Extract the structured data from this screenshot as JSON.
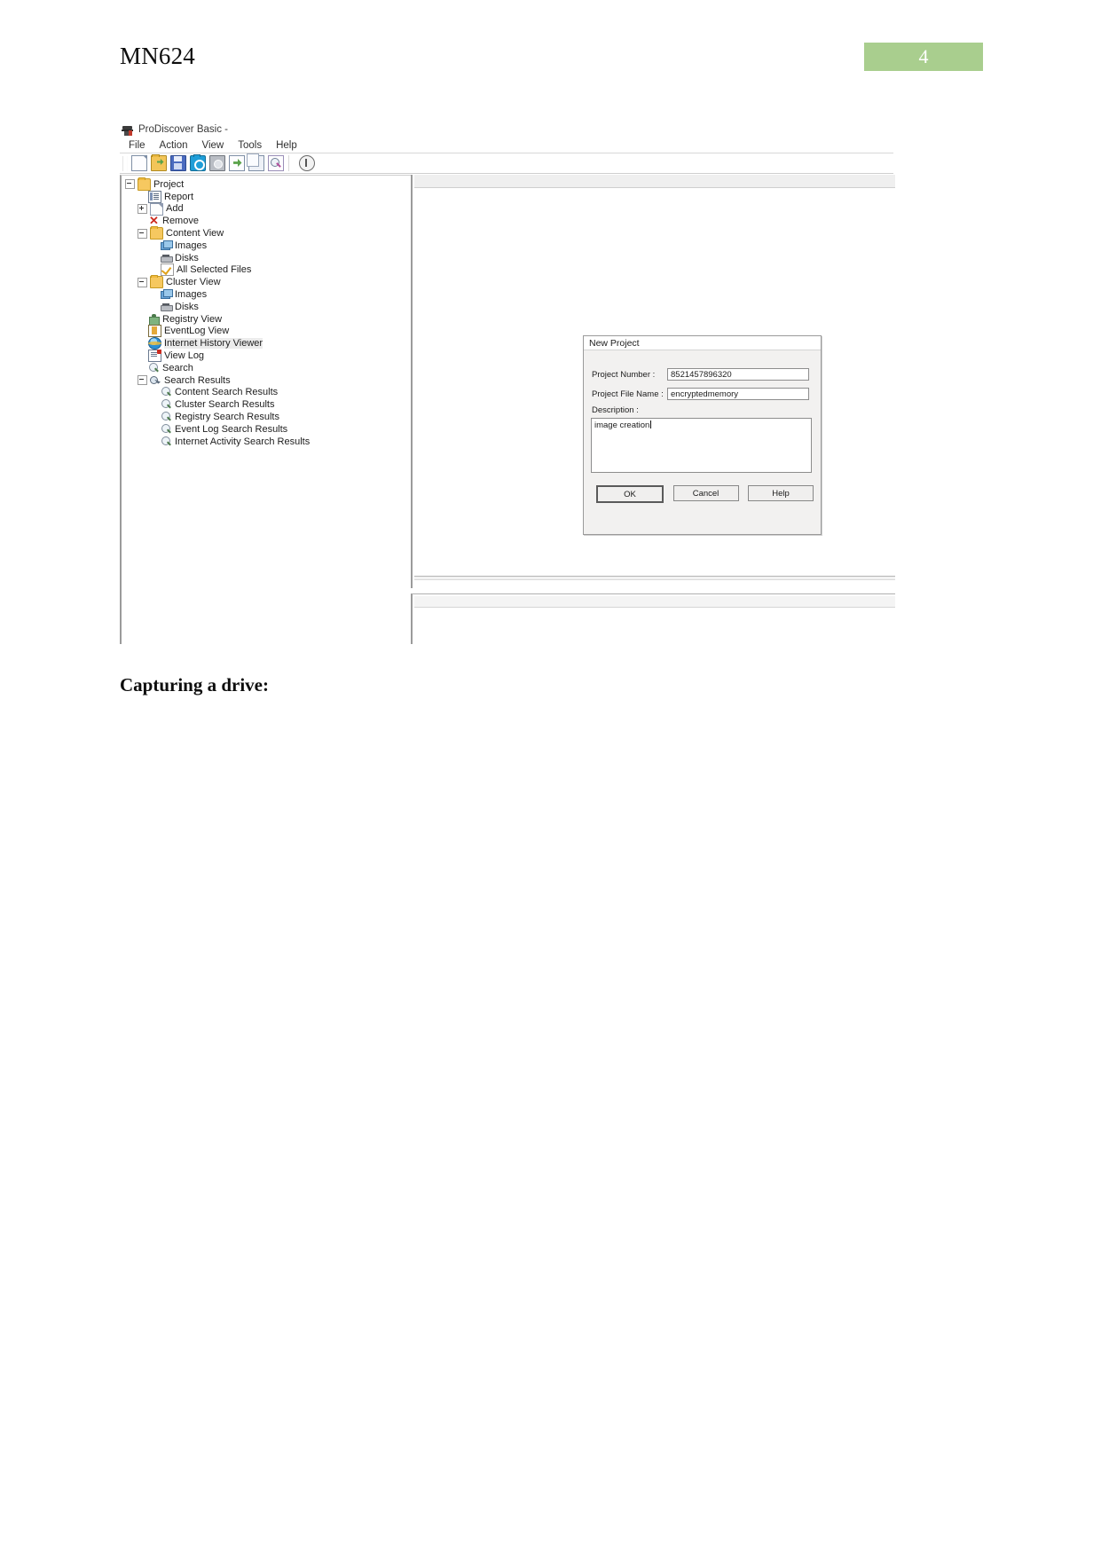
{
  "document": {
    "header_title": "MN624",
    "page_number": "4",
    "caption": "Capturing a drive:",
    "accent_color": "#a9ce8e"
  },
  "app": {
    "title": "ProDiscover Basic -",
    "window_icon": "prodiscover-detective-icon",
    "menu": [
      {
        "label": "File"
      },
      {
        "label": "Action"
      },
      {
        "label": "View"
      },
      {
        "label": "Tools"
      },
      {
        "label": "Help"
      }
    ],
    "toolbar": [
      {
        "name": "new-project-icon",
        "glyph": "g-new",
        "title": "New Project"
      },
      {
        "name": "open-project-icon",
        "glyph": "g-open",
        "title": "Open Project"
      },
      {
        "name": "save-project-icon",
        "glyph": "g-save",
        "title": "Save Project"
      },
      {
        "name": "capture-image-icon",
        "glyph": "g-cam",
        "title": "Capture Image"
      },
      {
        "name": "add-image-icon",
        "glyph": "g-disksave",
        "title": "Add Image"
      },
      {
        "name": "add-disk-icon",
        "glyph": "g-docarrow",
        "title": "Add Disk"
      },
      {
        "name": "copy-icon",
        "glyph": "g-copy",
        "title": "Copy"
      },
      {
        "name": "search-icon",
        "glyph": "g-find",
        "title": "Search"
      },
      {
        "name": "about-icon",
        "glyph": "g-info",
        "title": "About"
      }
    ],
    "tree": [
      {
        "label": "Project",
        "indent": 0,
        "toggle": "minus",
        "icon": "ico-folder",
        "icon_name": "folder-icon"
      },
      {
        "label": "Report",
        "indent": 1,
        "toggle": "none",
        "icon": "ico-report",
        "icon_name": "report-icon"
      },
      {
        "label": "Add",
        "indent": 1,
        "toggle": "plus",
        "icon": "ico-doc",
        "icon_name": "document-add-icon"
      },
      {
        "label": "Remove",
        "indent": 1,
        "toggle": "none",
        "icon": "ico-x",
        "icon_name": "remove-x-icon"
      },
      {
        "label": "Content View",
        "indent": 1,
        "toggle": "minus",
        "icon": "ico-folder",
        "icon_name": "folder-icon"
      },
      {
        "label": "Images",
        "indent": 2,
        "toggle": "none",
        "icon": "ico-images",
        "icon_name": "images-icon"
      },
      {
        "label": "Disks",
        "indent": 2,
        "toggle": "none",
        "icon": "ico-disk",
        "icon_name": "disk-icon"
      },
      {
        "label": "All Selected Files",
        "indent": 2,
        "toggle": "none",
        "icon": "ico-check",
        "icon_name": "checked-files-icon"
      },
      {
        "label": "Cluster View",
        "indent": 1,
        "toggle": "minus",
        "icon": "ico-folder",
        "icon_name": "folder-icon"
      },
      {
        "label": "Images",
        "indent": 2,
        "toggle": "none",
        "icon": "ico-images",
        "icon_name": "images-icon"
      },
      {
        "label": "Disks",
        "indent": 2,
        "toggle": "none",
        "icon": "ico-disk",
        "icon_name": "disk-icon"
      },
      {
        "label": "Registry View",
        "indent": 1,
        "toggle": "none",
        "icon": "ico-reg",
        "icon_name": "registry-icon"
      },
      {
        "label": "EventLog View",
        "indent": 1,
        "toggle": "none",
        "icon": "ico-event",
        "icon_name": "eventlog-icon"
      },
      {
        "label": "Internet History Viewer",
        "indent": 1,
        "toggle": "none",
        "icon": "ico-ie",
        "icon_name": "internet-explorer-icon",
        "highlight": true
      },
      {
        "label": "View Log",
        "indent": 1,
        "toggle": "none",
        "icon": "ico-viewlog",
        "icon_name": "view-log-icon"
      },
      {
        "label": "Search",
        "indent": 1,
        "toggle": "none",
        "icon": "ico-search",
        "icon_name": "magnifier-icon"
      },
      {
        "label": "Search Results",
        "indent": 1,
        "toggle": "minus",
        "icon": "ico-sr",
        "icon_name": "search-results-icon"
      },
      {
        "label": "Content Search Results",
        "indent": 2,
        "toggle": "none",
        "icon": "ico-search",
        "icon_name": "magnifier-icon"
      },
      {
        "label": "Cluster Search Results",
        "indent": 2,
        "toggle": "none",
        "icon": "ico-search",
        "icon_name": "magnifier-icon"
      },
      {
        "label": "Registry Search Results",
        "indent": 2,
        "toggle": "none",
        "icon": "ico-search",
        "icon_name": "magnifier-icon"
      },
      {
        "label": "Event Log Search Results",
        "indent": 2,
        "toggle": "none",
        "icon": "ico-search",
        "icon_name": "magnifier-icon"
      },
      {
        "label": "Internet Activity Search Results",
        "indent": 2,
        "toggle": "none",
        "icon": "ico-search",
        "icon_name": "magnifier-icon"
      }
    ]
  },
  "dialog": {
    "title": "New Project",
    "project_number_label": "Project Number :",
    "project_number_value": "8521457896320",
    "project_file_name_label": "Project File Name :",
    "project_file_name_value": "encryptedmemory",
    "description_label": "Description :",
    "description_value": "image creation",
    "buttons": {
      "ok": "OK",
      "cancel": "Cancel",
      "help": "Help"
    }
  }
}
